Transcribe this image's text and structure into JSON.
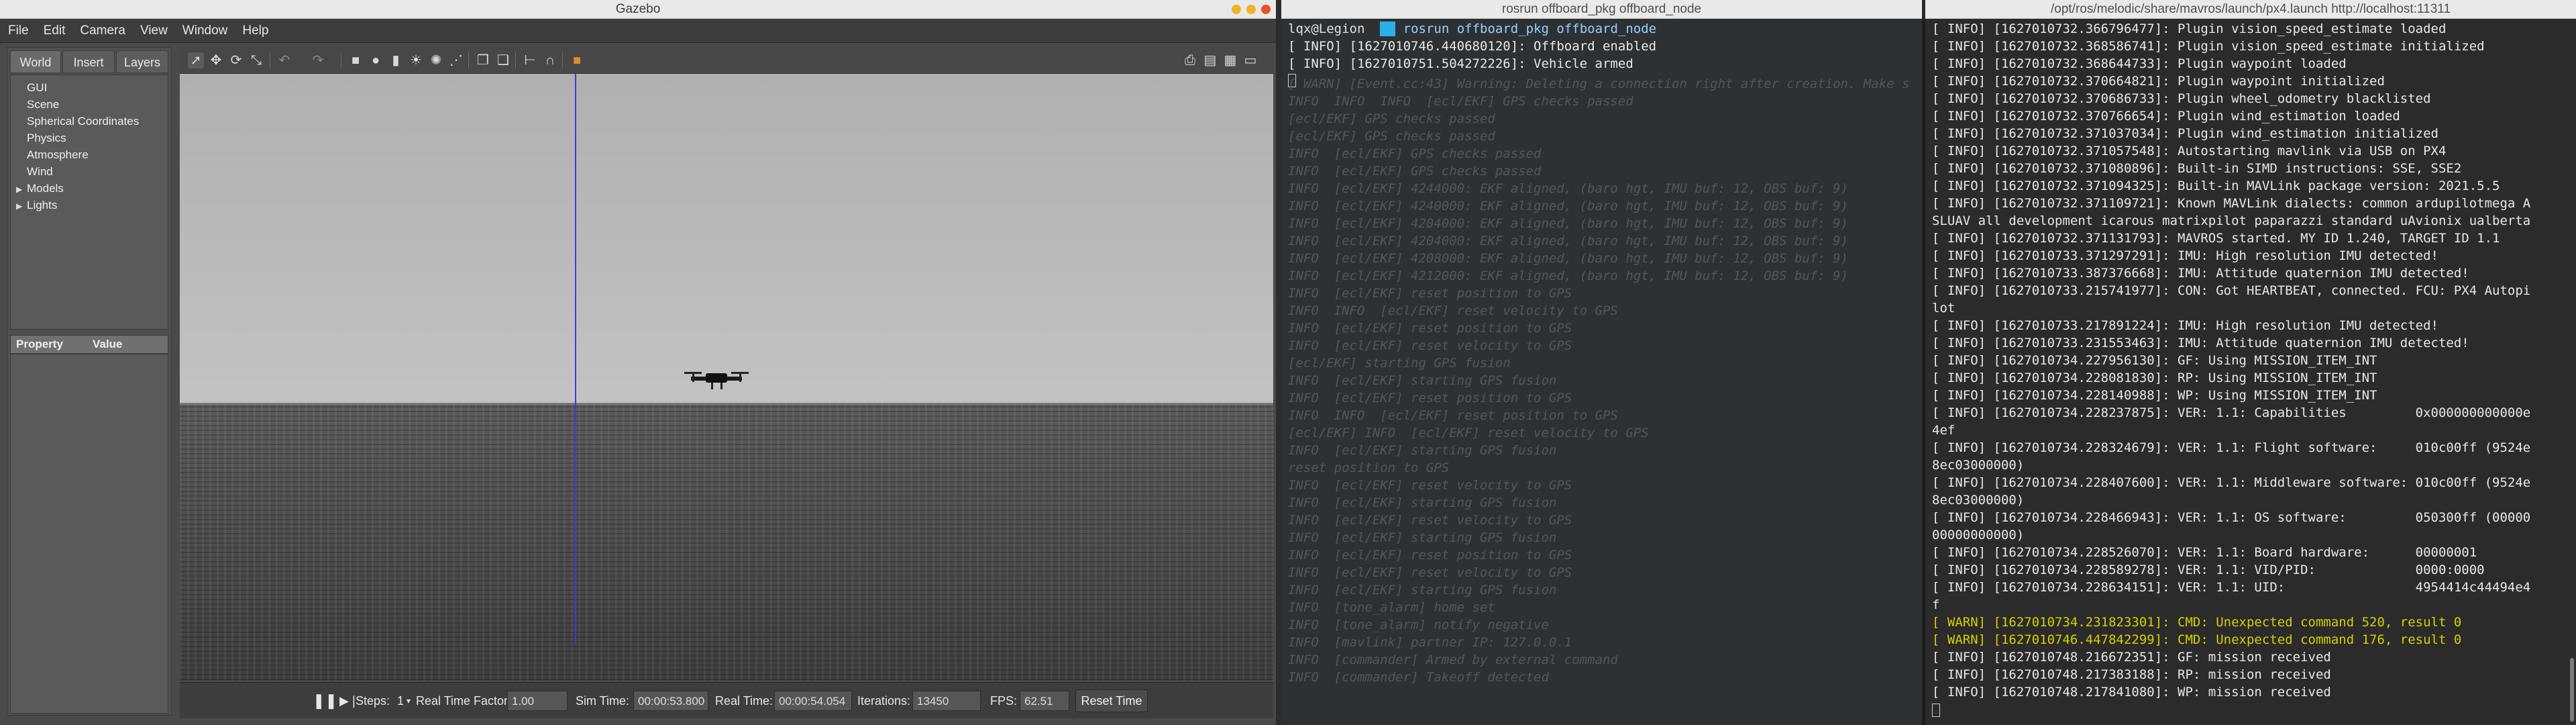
{
  "gazebo": {
    "title": "Gazebo",
    "menu": [
      "File",
      "Edit",
      "Camera",
      "View",
      "Window",
      "Help"
    ],
    "tabs": [
      "World",
      "Insert",
      "Layers"
    ],
    "tree": [
      "GUI",
      "Scene",
      "Spherical Coordinates",
      "Physics",
      "Atmosphere",
      "Wind"
    ],
    "tree_expandable": [
      "Models",
      "Lights"
    ],
    "property_header": "Property",
    "value_header": "Value",
    "steps_label": "Steps:",
    "steps_value": "1",
    "rtf_label": "Real Time Factor:",
    "rtf_value": "1.00",
    "sim_time_label": "Sim Time:",
    "sim_time_value": "00:00:53.800",
    "real_time_label": "Real Time:",
    "real_time_value": "00:00:54.054",
    "iterations_label": "Iterations:",
    "iterations_value": "13450",
    "fps_label": "FPS:",
    "fps_value": "62.51",
    "reset_label": "Reset Time"
  },
  "term1": {
    "title": "rosrun offboard_pkg offboard_node",
    "prompt_user": "lqx@Legion",
    "prompt_cmd": "rosrun offboard_pkg offboard_node",
    "lines": [
      "[ INFO] [1627010746.440680120]: Offboard enabled",
      "[ INFO] [1627010751.504272226]: Vehicle armed"
    ],
    "faded": [
      "[ WARN] [Event.cc:43] Warning: Deleting a connection right after creation. Make s",
      "INFO  INFO  INFO  [ecl/EKF] GPS checks passed",
      "[ecl/EKF] GPS checks passed",
      "[ecl/EKF] GPS checks passed",
      "INFO  [ecl/EKF] GPS checks passed",
      "INFO  [ecl/EKF] GPS checks passed",
      "INFO  [ecl/EKF] 4244000: EKF aligned, (baro hgt, IMU buf: 12, OBS buf: 9)",
      "INFO  [ecl/EKF] 4240000: EKF aligned, (baro hgt, IMU buf: 12, OBS buf: 9)",
      "INFO  [ecl/EKF] 4204000: EKF aligned, (baro hgt, IMU buf: 12, OBS buf: 9)",
      "INFO  [ecl/EKF] 4204000: EKF aligned, (baro hgt, IMU buf: 12, OBS buf: 9)",
      "INFO  [ecl/EKF] 4208000: EKF aligned, (baro hgt, IMU buf: 12, OBS buf: 9)",
      "INFO  [ecl/EKF] 4212000: EKF aligned, (baro hgt, IMU buf: 12, OBS buf: 9)",
      "INFO  [ecl/EKF] reset position to GPS",
      "INFO  INFO  [ecl/EKF] reset velocity to GPS",
      "INFO  [ecl/EKF] reset position to GPS",
      "INFO  [ecl/EKF] reset velocity to GPS",
      "[ecl/EKF] starting GPS fusion",
      "INFO  [ecl/EKF] starting GPS fusion",
      "INFO  [ecl/EKF] reset position to GPS",
      "INFO  INFO  [ecl/EKF] reset position to GPS",
      "[ecl/EKF] INFO  [ecl/EKF] reset velocity to GPS",
      "INFO  [ecl/EKF] starting GPS fusion",
      "reset position to GPS",
      "INFO  [ecl/EKF] reset velocity to GPS",
      "INFO  [ecl/EKF] starting GPS fusion",
      "INFO  [ecl/EKF] reset velocity to GPS",
      "INFO  [ecl/EKF] starting GPS fusion",
      "INFO  [ecl/EKF] reset position to GPS",
      "INFO  [ecl/EKF] reset velocity to GPS",
      "INFO  [ecl/EKF] starting GPS fusion",
      "INFO  [tone_alarm] home set",
      "INFO  [tone_alarm] notify negative",
      "INFO  [mavlink] partner IP: 127.0.0.1",
      "INFO  [commander] Armed by external command",
      "INFO  [commander] Takeoff detected"
    ]
  },
  "term2": {
    "title": "/opt/ros/melodic/share/mavros/launch/px4.launch http://localhost:11311",
    "lines": [
      {
        "t": "[ INFO] [1627010732.366796477]: Plugin vision_speed_estimate loaded",
        "c": "info"
      },
      {
        "t": "[ INFO] [1627010732.368586741]: Plugin vision_speed_estimate initialized",
        "c": "info"
      },
      {
        "t": "[ INFO] [1627010732.368644733]: Plugin waypoint loaded",
        "c": "info"
      },
      {
        "t": "[ INFO] [1627010732.370664821]: Plugin waypoint initialized",
        "c": "info"
      },
      {
        "t": "[ INFO] [1627010732.370686733]: Plugin wheel_odometry blacklisted",
        "c": "info"
      },
      {
        "t": "[ INFO] [1627010732.370766654]: Plugin wind_estimation loaded",
        "c": "info"
      },
      {
        "t": "[ INFO] [1627010732.371037034]: Plugin wind_estimation initialized",
        "c": "info"
      },
      {
        "t": "[ INFO] [1627010732.371057548]: Autostarting mavlink via USB on PX4",
        "c": "info"
      },
      {
        "t": "[ INFO] [1627010732.371080896]: Built-in SIMD instructions: SSE, SSE2",
        "c": "info"
      },
      {
        "t": "[ INFO] [1627010732.371094325]: Built-in MAVLink package version: 2021.5.5",
        "c": "info"
      },
      {
        "t": "[ INFO] [1627010732.371109721]: Known MAVLink dialects: common ardupilotmega A",
        "c": "info"
      },
      {
        "t": "SLUAV all development icarous matrixpilot paparazzi standard uAvionix ualberta",
        "c": "info"
      },
      {
        "t": "[ INFO] [1627010732.371131793]: MAVROS started. MY ID 1.240, TARGET ID 1.1",
        "c": "info"
      },
      {
        "t": "[ INFO] [1627010733.371297291]: IMU: High resolution IMU detected!",
        "c": "info"
      },
      {
        "t": "[ INFO] [1627010733.387376668]: IMU: Attitude quaternion IMU detected!",
        "c": "info"
      },
      {
        "t": "[ INFO] [1627010733.215741977]: CON: Got HEARTBEAT, connected. FCU: PX4 Autopi",
        "c": "info"
      },
      {
        "t": "lot",
        "c": "info"
      },
      {
        "t": "[ INFO] [1627010733.217891224]: IMU: High resolution IMU detected!",
        "c": "info"
      },
      {
        "t": "[ INFO] [1627010733.231553463]: IMU: Attitude quaternion IMU detected!",
        "c": "info"
      },
      {
        "t": "[ INFO] [1627010734.227956130]: GF: Using MISSION_ITEM_INT",
        "c": "info"
      },
      {
        "t": "[ INFO] [1627010734.228081830]: RP: Using MISSION_ITEM_INT",
        "c": "info"
      },
      {
        "t": "[ INFO] [1627010734.228140988]: WP: Using MISSION_ITEM_INT",
        "c": "info"
      },
      {
        "t": "[ INFO] [1627010734.228237875]: VER: 1.1: Capabilities         0x000000000000e",
        "c": "info"
      },
      {
        "t": "4ef",
        "c": "info"
      },
      {
        "t": "[ INFO] [1627010734.228324679]: VER: 1.1: Flight software:     010c00ff (9524e",
        "c": "info"
      },
      {
        "t": "8ec03000000)",
        "c": "info"
      },
      {
        "t": "[ INFO] [1627010734.228407600]: VER: 1.1: Middleware software: 010c00ff (9524e",
        "c": "info"
      },
      {
        "t": "8ec03000000)",
        "c": "info"
      },
      {
        "t": "[ INFO] [1627010734.228466943]: VER: 1.1: OS software:         050300ff (00000",
        "c": "info"
      },
      {
        "t": "00000000000)",
        "c": "info"
      },
      {
        "t": "[ INFO] [1627010734.228526070]: VER: 1.1: Board hardware:      00000001",
        "c": "info"
      },
      {
        "t": "[ INFO] [1627010734.228589278]: VER: 1.1: VID/PID:             0000:0000",
        "c": "info"
      },
      {
        "t": "[ INFO] [1627010734.228634151]: VER: 1.1: UID:                 4954414c44494e4",
        "c": "info"
      },
      {
        "t": "f",
        "c": "info"
      },
      {
        "t": "[ WARN] [1627010734.231823301]: CMD: Unexpected command 520, result 0",
        "c": "warn"
      },
      {
        "t": "[ WARN] [1627010746.447842299]: CMD: Unexpected command 176, result 0",
        "c": "warn"
      },
      {
        "t": "[ INFO] [1627010748.216672351]: GF: mission received",
        "c": "info"
      },
      {
        "t": "[ INFO] [1627010748.217383188]: RP: mission received",
        "c": "info"
      },
      {
        "t": "[ INFO] [1627010748.217841080]: WP: mission received",
        "c": "info"
      }
    ]
  },
  "colors": {
    "info": "#e8e8e8",
    "warn": "#d4d000",
    "prompt_user": "#e0e0e0",
    "prompt_arrow": "#2ab0e6",
    "prompt_cmd": "#9ad0ff"
  }
}
